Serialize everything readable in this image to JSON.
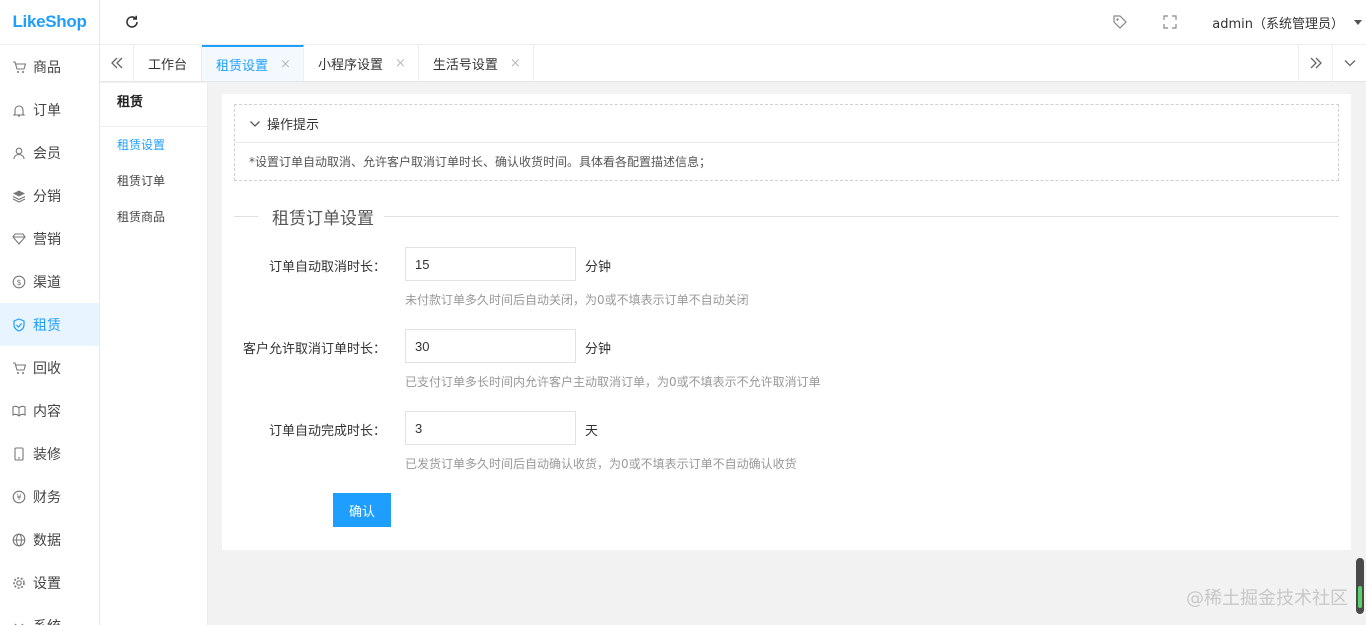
{
  "app": {
    "logo": "LikeShop"
  },
  "sidebar": {
    "items": [
      {
        "label": "商品",
        "icon": "cart-icon"
      },
      {
        "label": "订单",
        "icon": "bell-icon"
      },
      {
        "label": "会员",
        "icon": "user-icon"
      },
      {
        "label": "分销",
        "icon": "layers-icon"
      },
      {
        "label": "营销",
        "icon": "diamond-icon"
      },
      {
        "label": "渠道",
        "icon": "dollar-circle-icon"
      },
      {
        "label": "租赁",
        "icon": "shield-check-icon",
        "active": true
      },
      {
        "label": "回收",
        "icon": "cart-icon"
      },
      {
        "label": "内容",
        "icon": "book-icon"
      },
      {
        "label": "装修",
        "icon": "tablet-icon"
      },
      {
        "label": "财务",
        "icon": "yen-icon"
      },
      {
        "label": "数据",
        "icon": "globe-icon"
      },
      {
        "label": "设置",
        "icon": "gear-icon"
      },
      {
        "label": "系统",
        "icon": "chevron-icon"
      }
    ]
  },
  "header": {
    "user": "admin（系统管理员）"
  },
  "tabs": [
    {
      "label": "工作台",
      "closable": false
    },
    {
      "label": "租赁设置",
      "closable": true,
      "active": true
    },
    {
      "label": "小程序设置",
      "closable": true
    },
    {
      "label": "生活号设置",
      "closable": true
    }
  ],
  "subnav": {
    "title": "租赁",
    "items": [
      {
        "label": "租赁设置",
        "active": true
      },
      {
        "label": "租赁订单"
      },
      {
        "label": "租赁商品"
      }
    ]
  },
  "tips": {
    "title": "操作提示",
    "text": "*设置订单自动取消、允许客户取消订单时长、确认收货时间。具体看各配置描述信息；"
  },
  "form": {
    "section_title": "租赁订单设置",
    "fields": [
      {
        "label": "订单自动取消时长：",
        "value": "15",
        "unit": "分钟",
        "help": "未付款订单多久时间后自动关闭，为0或不填表示订单不自动关闭"
      },
      {
        "label": "客户允许取消订单时长：",
        "value": "30",
        "unit": "分钟",
        "help": "已支付订单多长时间内允许客户主动取消订单，为0或不填表示不允许取消订单"
      },
      {
        "label": "订单自动完成时长：",
        "value": "3",
        "unit": "天",
        "help": "已发货订单多久时间后自动确认收货，为0或不填表示订单不自动确认收货"
      }
    ],
    "confirm_label": "确认"
  },
  "watermark": "@稀土掘金技术社区",
  "colors": {
    "accent": "#1e9fff"
  }
}
